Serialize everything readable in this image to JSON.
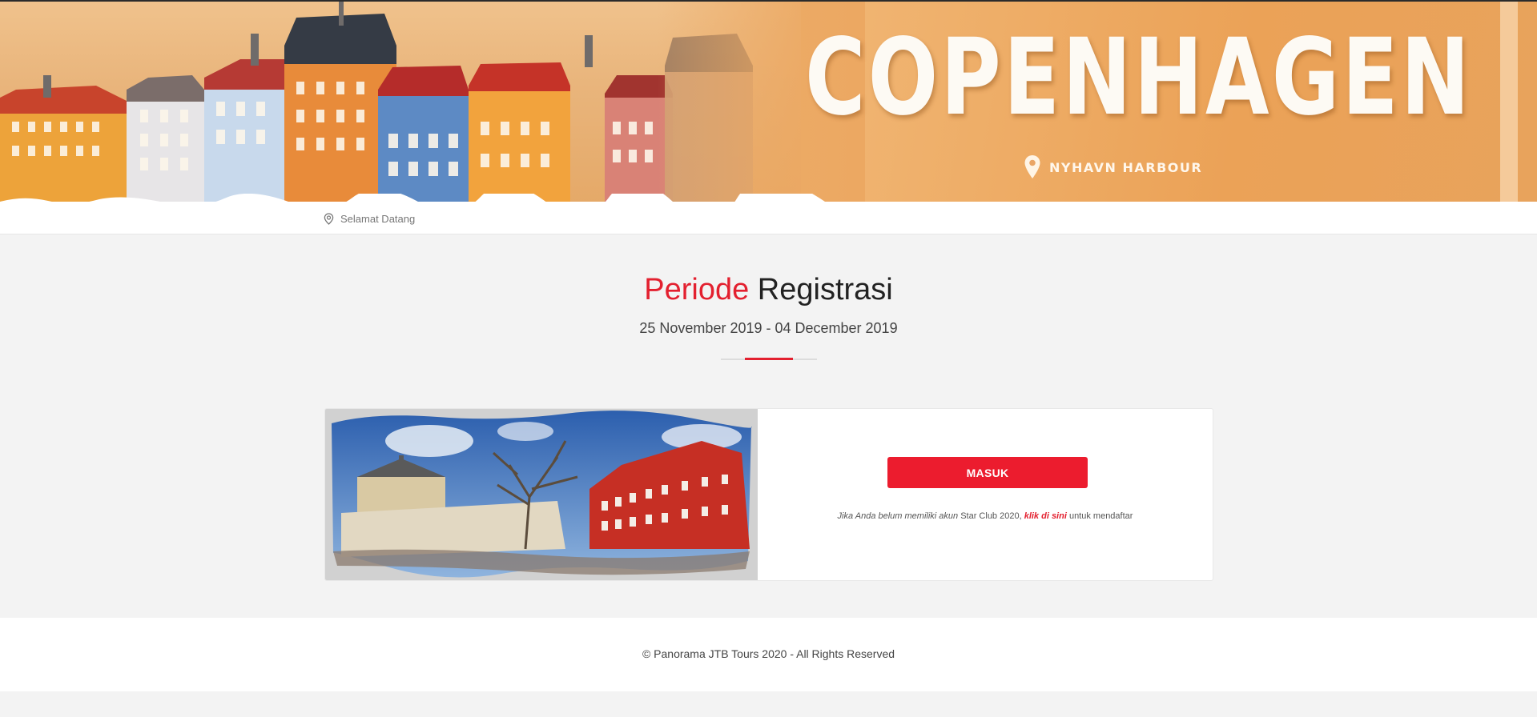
{
  "banner": {
    "title": "COPENHAGEN",
    "subtitle": "NYHAVN HARBOUR",
    "pin_icon": "map-pin-icon"
  },
  "breadcrumb": {
    "icon": "location-icon",
    "label": "Selamat Datang"
  },
  "registration": {
    "title_accent": "Periode",
    "title_rest": " Registrasi",
    "date_range": "25 November 2019 - 04 December 2019"
  },
  "login": {
    "button_label": "MASUK",
    "note_prefix": "Jika Anda belum memiliki akun",
    "note_club": " Star Club 2020, ",
    "note_link": "klik di sini",
    "note_suffix": " untuk mendaftar"
  },
  "footer": {
    "copyright": "© Panorama JTB Tours 2020 - All Rights Reserved"
  },
  "colors": {
    "accent": "#e3202f",
    "button": "#ec1c2e",
    "page_bg": "#f3f3f3"
  }
}
